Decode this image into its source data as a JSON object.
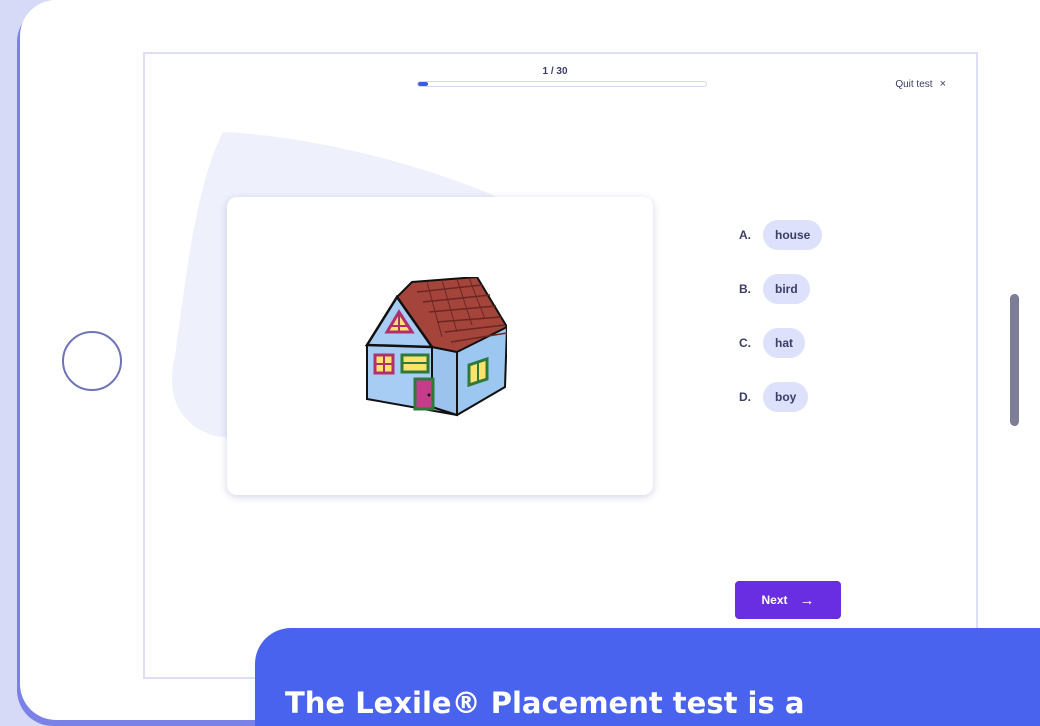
{
  "progress": {
    "label": "1 / 30",
    "current": 1,
    "total": 30
  },
  "quit": {
    "label": "Quit test",
    "icon": "×"
  },
  "question": {
    "image_icon": "house-illustration"
  },
  "options": [
    {
      "letter": "A.",
      "word": "house"
    },
    {
      "letter": "B.",
      "word": "bird"
    },
    {
      "letter": "C.",
      "word": "hat"
    },
    {
      "letter": "D.",
      "word": "boy"
    }
  ],
  "next": {
    "label": "Next",
    "icon": "→"
  },
  "banner": {
    "text": "The Lexile® Placement test is a"
  },
  "colors": {
    "accent": "#6a2ee2",
    "progress": "#3d5ae6",
    "banner": "#4a63ee",
    "option_bg": "#dde1fb",
    "backdrop": "#d6daf7"
  }
}
